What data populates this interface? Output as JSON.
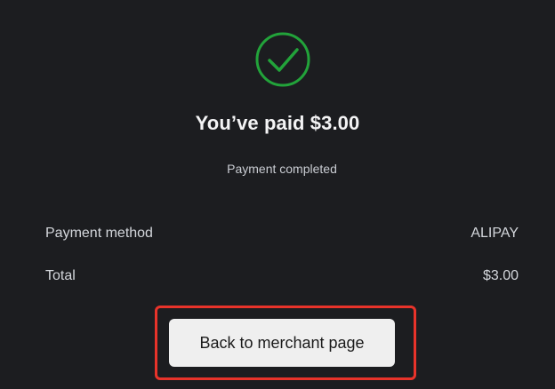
{
  "header": {
    "icon": "check-circle-icon",
    "title": "You’ve paid $3.00",
    "status": "Payment completed"
  },
  "details": {
    "method_label": "Payment method",
    "method_value": "ALIPAY",
    "total_label": "Total",
    "total_value": "$3.00"
  },
  "actions": {
    "back_label": "Back to merchant page"
  },
  "colors": {
    "background": "#1c1d20",
    "success": "#22a33a",
    "highlight": "#e8332a",
    "button_bg": "#efefef"
  }
}
